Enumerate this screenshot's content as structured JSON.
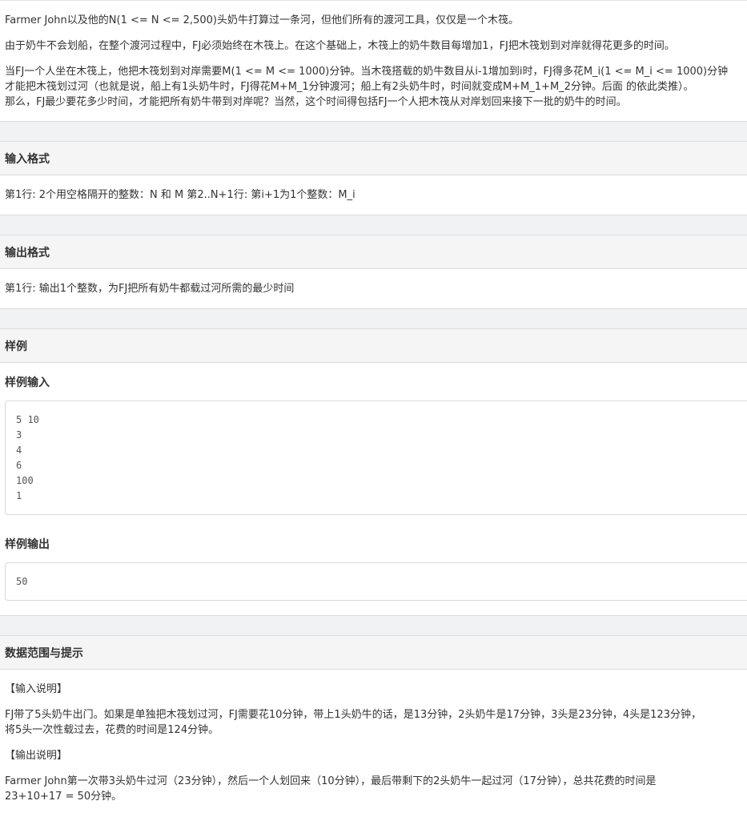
{
  "description": {
    "p1": "Farmer John以及他的N(1 <= N <= 2,500)头奶牛打算过一条河，但他们所有的渡河工具，仅仅是一个木筏。",
    "p2": "由于奶牛不会划船，在整个渡河过程中，FJ必须始终在木筏上。在这个基础上，木筏上的奶牛数目每增加1，FJ把木筏划到对岸就得花更多的时间。",
    "p3_line1": "当FJ一个人坐在木筏上，他把木筏划到对岸需要M(1 <= M <= 1000)分钟。当木筏搭载的奶牛数目从i-1增加到i时，FJ得多花M_i(1 <= M_i <= 1000)分钟",
    "p3_line2": "才能把木筏划过河（也就是说，船上有1头奶牛时，FJ得花M+M_1分钟渡河；船上有2头奶牛时，时间就变成M+M_1+M_2分钟。后面 的依此类推）。",
    "p3_line3": "那么，FJ最少要花多少时间，才能把所有奶牛带到对岸呢？当然，这个时间得包括FJ一个人把木筏从对岸划回来接下一批的奶牛的时间。"
  },
  "input_format": {
    "title": "输入格式",
    "text": "第1行: 2个用空格隔开的整数：N 和 M 第2..N+1行: 第i+1为1个整数：M_i"
  },
  "output_format": {
    "title": "输出格式",
    "text": "第1行: 输出1个整数，为FJ把所有奶牛都载过河所需的最少时间"
  },
  "sample": {
    "title": "样例",
    "input_title": "样例输入",
    "input_lines": [
      "5 10",
      "3",
      "4",
      "6",
      "100",
      "1"
    ],
    "output_title": "样例输出",
    "output_lines": [
      "50"
    ]
  },
  "hints": {
    "title": "数据范围与提示",
    "input_note_title": "【输入说明】",
    "input_note_line1": "FJ带了5头奶牛出门。如果是单独把木筏划过河，FJ需要花10分钟，带上1头奶牛的话，是13分钟，2头奶牛是17分钟，3头是23分钟，4头是123分钟，",
    "input_note_line2": "将5头一次性载过去，花费的时间是124分钟。",
    "output_note_title": "【输出说明】",
    "output_note_line1": "Farmer John第一次带3头奶牛过河（23分钟），然后一个人划回来（10分钟），最后带剩下的2头奶牛一起过河（17分钟），总共花费的时间是",
    "output_note_line2": "23+10+17 = 50分钟。"
  }
}
